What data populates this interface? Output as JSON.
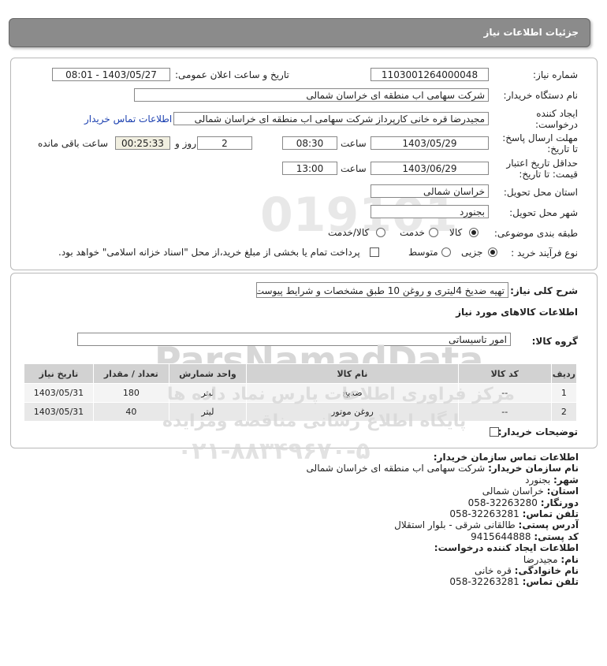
{
  "title": "جزئیات اطلاعات نیاز",
  "fields": {
    "need_number_label": "شماره نیاز:",
    "need_number": "1103001264000048",
    "announce_label": "تاریخ و ساعت اعلان عمومی:",
    "announce_value": "1403/05/27 - 08:01",
    "buyer_name_label": "نام دستگاه خریدار:",
    "buyer_name": "شرکت سهامی اب منطقه ای خراسان شمالی",
    "creator_label_1": "ایجاد کننده",
    "creator_label_2": "درخواست:",
    "creator": "مجیدرضا قره خانی کارپرداز شرکت سهامی اب منطقه ای خراسان شمالی",
    "contact_link": "اطلاعات تماس خریدار",
    "reply_deadline_label_1": "مهلت ارسال پاسخ:",
    "reply_deadline_label_2": "تا تاریخ:",
    "reply_date": "1403/05/29",
    "time_label": "ساعت",
    "reply_time": "08:30",
    "days": "2",
    "days_label": "روز و",
    "remaining": "00:25:33",
    "remaining_label": "ساعت باقی مانده",
    "validity_label_1": "حداقل تاریخ اعتبار",
    "validity_label_2": "قیمت: تا تاریخ:",
    "validity_date": "1403/06/29",
    "validity_time": "13:00",
    "province_label": "استان محل تحویل:",
    "province": "خراسان شمالی",
    "city_label": "شهر محل تحویل:",
    "city": "بجنورد",
    "category_label": "طبقه بندی موضوعی:",
    "category_options": [
      "کالا",
      "خدمت",
      "کالا/خدمت"
    ],
    "category_selected": "کالا",
    "process_label": "نوع فرآیند خرید :",
    "process_options": [
      "جزیی",
      "متوسط"
    ],
    "process_selected": "جزیی",
    "treasury_text": "پرداخت تمام یا بخشی از مبلغ خرید،از محل \"اسناد خزانه اسلامی\" خواهد بود."
  },
  "summary": {
    "label": "شرح کلی نیاز:",
    "value": "تهیه ضدیخ 4لیتری و روغن 10 طبق مشخصات و شرایط پیوست"
  },
  "goods": {
    "section_title": "اطلاعات کالاهای مورد نیاز",
    "group_label": "گروه کالا:",
    "group_value": "امور تاسیساتی",
    "columns": [
      "ردیف",
      "کد کالا",
      "نام کالا",
      "واحد شمارش",
      "تعداد / مقدار",
      "تاریخ نیاز"
    ],
    "rows": [
      {
        "row": "1",
        "code": "--",
        "name": "ضدیخ",
        "unit": "لیتر",
        "qty": "180",
        "date": "1403/05/31"
      },
      {
        "row": "2",
        "code": "--",
        "name": "روغن موتور",
        "unit": "لیتر",
        "qty": "40",
        "date": "1403/05/31"
      }
    ],
    "buyer_notes_label": "توضیحات خریدار:"
  },
  "contact": {
    "heading": "اطلاعات تماس سازمان خریدار:",
    "org_label": "نام سازمان خریدار:",
    "org": "شرکت سهامی اب منطقه ای خراسان شمالی",
    "city_label": "شهر:",
    "city": "بجنورد",
    "province_label": "استان:",
    "province": "خراسان شمالی",
    "fax_label": "دورنگار:",
    "fax": "058-32263280",
    "phone_label": "تلفن تماس:",
    "phone": "058-32263281",
    "address_label": "آدرس پستی:",
    "address": "طالقانی شرقی - بلوار استقلال",
    "postal_label": "کد پستی:",
    "postal": "9415644888",
    "creator_heading": "اطلاعات ایجاد کننده درخواست:",
    "first_name_label": "نام:",
    "first_name": "مجیدرضا",
    "last_name_label": "نام خانوادگی:",
    "last_name": "قره خانی",
    "creator_phone_label": "تلفن تماس:",
    "creator_phone": "058-32263281"
  },
  "watermark": {
    "brand": "ParsNamadData",
    "line1": "مرکز فراوری اطلاعات پارس نماد داده ها",
    "line2": "پایگاه اطلاع رسانی مناقصه ومزایده",
    "phone": "۰۲۱-۸۸۳۴۹۶۷۰-۵",
    "number": "019101"
  }
}
